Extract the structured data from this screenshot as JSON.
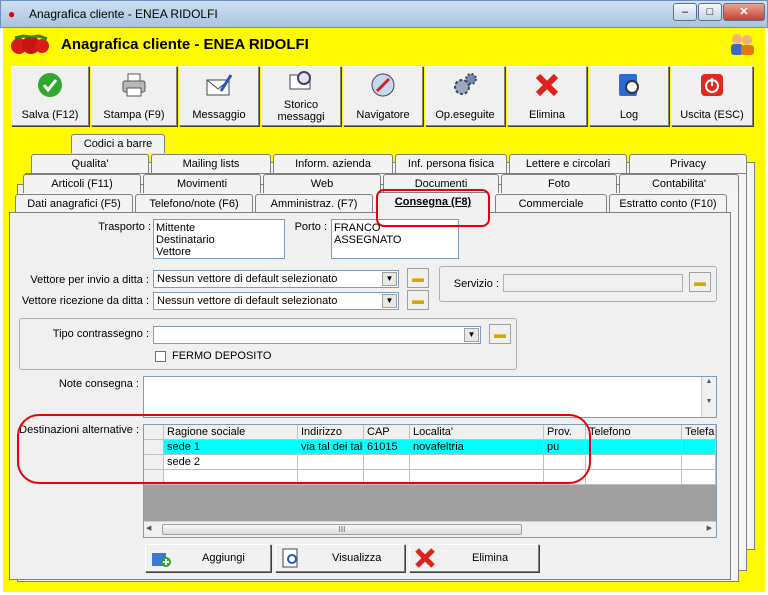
{
  "window": {
    "title": "Anagrafica cliente - ENEA RIDOLFI",
    "minimize": "–",
    "maximize": "□",
    "close": "✕"
  },
  "header": {
    "title": "Anagrafica cliente - ENEA RIDOLFI",
    "logo_icon": "strawberry-logo-icon",
    "users_icon": "users-icon"
  },
  "toolbar": {
    "salva": "Salva (F12)",
    "stampa": "Stampa (F9)",
    "messaggio": "Messaggio",
    "storico": "Storico messaggi",
    "navigatore": "Navigatore",
    "opeseguite": "Op.eseguite",
    "elimina": "Elimina",
    "log": "Log",
    "uscita": "Uscita (ESC)"
  },
  "tabs": {
    "row1": [
      "Codici a barre"
    ],
    "row2": [
      "Qualita'",
      "Mailing lists",
      "Inform. azienda",
      "Inf. persona fisica",
      "Lettere e circolari",
      "Privacy"
    ],
    "row3": [
      "Articoli (F11)",
      "Movimenti",
      "Web",
      "Documenti",
      "Foto",
      "Contabilita'"
    ],
    "row4": [
      "Dati anagrafici (F5)",
      "Telefono/note (F6)",
      "Amministraz. (F7)",
      "Consegna (F8)",
      "Commerciale",
      "Estratto conto (F10)"
    ]
  },
  "form": {
    "trasporto_label": "Trasporto :",
    "trasporto_items": [
      "Mittente",
      "Destinatario",
      "Vettore"
    ],
    "porto_label": "Porto :",
    "porto_items": [
      "FRANCO",
      "ASSEGNATO"
    ],
    "vettore_invio_label": "Vettore per invio a ditta :",
    "vettore_invio_value": "Nessun vettore di default selezionato",
    "vettore_ricezione_label": "Vettore ricezione da ditta :",
    "vettore_ricezione_value": "Nessun vettore di default selezionato",
    "servizio_label": "Servizio :",
    "tipo_contrassegno_label": "Tipo contrassegno :",
    "fermo_deposito_label": "FERMO DEPOSITO",
    "note_consegna_label": "Note consegna :",
    "destinazioni_label": "Destinazioni alternative :"
  },
  "grid": {
    "headers": [
      "Ragione sociale",
      "Indirizzo",
      "CAP",
      "Localita'",
      "Prov.",
      "Telefono",
      "Telefa"
    ],
    "rows": [
      [
        "sede 1",
        "via tal dei tali",
        "61015",
        "novafeltria",
        "pu",
        "",
        ""
      ],
      [
        "sede 2",
        "",
        "",
        "",
        "",
        "",
        ""
      ],
      [
        "",
        "",
        "",
        "",
        "",
        "",
        ""
      ]
    ],
    "scroll_thumb": "III"
  },
  "buttons": {
    "aggiungi": "Aggiungi",
    "visualizza": "Visualizza",
    "elimina": "Elimina"
  },
  "colors": {
    "yellow": "#fffa00",
    "selected_row": "#00ffff",
    "highlight": "#e8000b"
  }
}
